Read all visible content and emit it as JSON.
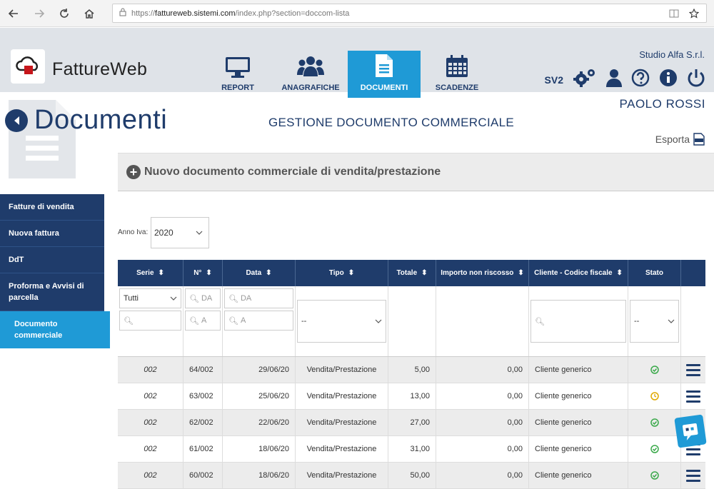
{
  "browser": {
    "url_prefix": "https://",
    "url_domain": "fattureweb.sistemi.com",
    "url_path": "/index.php?section=doccom-lista"
  },
  "app": {
    "logo_text": "FattureWeb",
    "studio": "Studio Alfa S.r.l.",
    "version": "SV2",
    "user": "PAOLO ROSSI"
  },
  "nav": [
    {
      "label": "REPORT",
      "icon": "monitor-icon"
    },
    {
      "label": "ANAGRAFICHE",
      "icon": "users-icon"
    },
    {
      "label": "DOCUMENTI",
      "icon": "document-icon"
    },
    {
      "label": "SCADENZE",
      "icon": "calendar-icon"
    }
  ],
  "page": {
    "title": "Documenti",
    "subtitle": "GESTIONE DOCUMENTO COMMERCIALE",
    "export_label": "Esporta",
    "new_doc_label": "Nuovo documento commerciale di vendita/prestazione",
    "anno_label": "Anno Iva:",
    "anno_value": "2020"
  },
  "sidebar": [
    {
      "label": "Fatture di vendita"
    },
    {
      "label": "Nuova fattura"
    },
    {
      "label": "DdT"
    },
    {
      "label": "Proforma e Avvisi di parcella"
    },
    {
      "label": "Documento commerciale"
    }
  ],
  "table": {
    "columns": [
      "Serie",
      "N°",
      "Data",
      "Tipo",
      "Totale",
      "Importo non riscosso",
      "Cliente - Codice fiscale",
      "Stato"
    ],
    "filters": {
      "serie": "Tutti",
      "num_from": "DA",
      "num_to": "A",
      "data_from": "DA",
      "data_to": "A",
      "tipo": "--",
      "stato": "--"
    },
    "rows": [
      {
        "serie": "002",
        "num": "64/002",
        "data": "29/06/20",
        "tipo": "Vendita/Prestazione",
        "totale": "5,00",
        "importo": "0,00",
        "cliente": "Cliente generico",
        "stato": "ok"
      },
      {
        "serie": "002",
        "num": "63/002",
        "data": "25/06/20",
        "tipo": "Vendita/Prestazione",
        "totale": "13,00",
        "importo": "0,00",
        "cliente": "Cliente generico",
        "stato": "pending"
      },
      {
        "serie": "002",
        "num": "62/002",
        "data": "22/06/20",
        "tipo": "Vendita/Prestazione",
        "totale": "27,00",
        "importo": "0,00",
        "cliente": "Cliente generico",
        "stato": "ok"
      },
      {
        "serie": "002",
        "num": "61/002",
        "data": "18/06/20",
        "tipo": "Vendita/Prestazione",
        "totale": "31,00",
        "importo": "0,00",
        "cliente": "Cliente generico",
        "stato": "ok"
      },
      {
        "serie": "002",
        "num": "60/002",
        "data": "18/06/20",
        "tipo": "Vendita/Prestazione",
        "totale": "50,00",
        "importo": "0,00",
        "cliente": "Cliente generico",
        "stato": "ok"
      }
    ]
  },
  "colors": {
    "navy": "#1f3c6b",
    "accent": "#1f9ad6",
    "ok": "#3aa94a",
    "pending": "#e0a800"
  }
}
